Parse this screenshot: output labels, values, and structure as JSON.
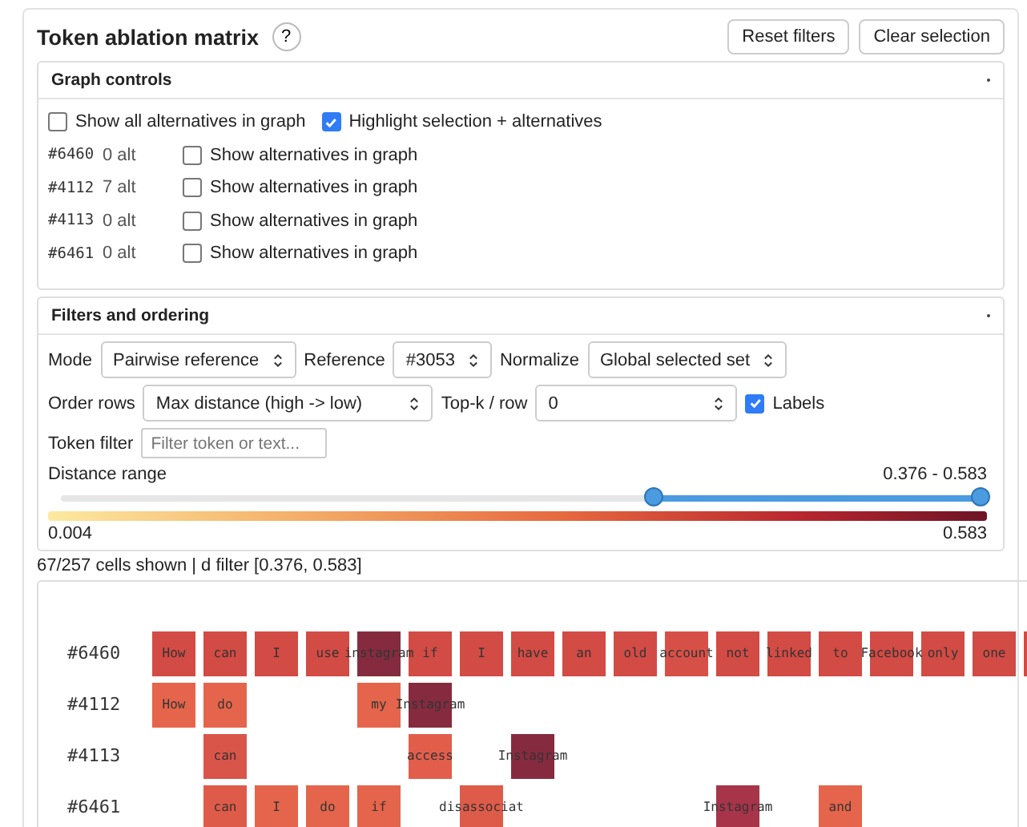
{
  "title": "Token ablation matrix",
  "help": "?",
  "buttons": [
    "Reset filters",
    "Clear selection"
  ],
  "graph_controls": {
    "title": "Graph controls",
    "options": [
      {
        "label": "Show all alternatives in graph",
        "checked": false
      },
      {
        "label": "Highlight selection + alternatives",
        "checked": true
      }
    ],
    "rows": [
      {
        "id": "#6460",
        "alt": "0 alt",
        "label": "Show alternatives in graph",
        "checked": false
      },
      {
        "id": "#4112",
        "alt": "7 alt",
        "label": "Show alternatives in graph",
        "checked": false
      },
      {
        "id": "#4113",
        "alt": "0 alt",
        "label": "Show alternatives in graph",
        "checked": false
      },
      {
        "id": "#6461",
        "alt": "0 alt",
        "label": "Show alternatives in graph",
        "checked": false
      }
    ]
  },
  "filters": {
    "title": "Filters and ordering",
    "mode": {
      "label": "Mode",
      "value": "Pairwise reference"
    },
    "reference": {
      "label": "Reference",
      "value": "#3053"
    },
    "normalize": {
      "label": "Normalize",
      "value": "Global selected set"
    },
    "order": {
      "label": "Order rows",
      "value": "Max distance (high -> low)"
    },
    "topk": {
      "label": "Top-k / row",
      "value": "0"
    },
    "labels": {
      "label": "Labels",
      "checked": true
    },
    "token_filter": {
      "label": "Token filter",
      "placeholder": "Filter token or text..."
    },
    "distance_range": {
      "label": "Distance range",
      "reading": "0.376 - 0.583",
      "low": {
        "level": 0.644
      },
      "high": {
        "level": 1
      }
    },
    "scale": {
      "min": "0.004",
      "max": "0.583"
    }
  },
  "status": "67/257 cells shown | d filter [0.376, 0.583]",
  "matrix": {
    "rows": [
      {
        "id": "#6460",
        "cells": [
          {
            "token": "How",
            "color": "#d24b44"
          },
          {
            "token": "can",
            "color": "#d24b44"
          },
          {
            "token": "I",
            "color": "#d24b44"
          },
          {
            "token": "use",
            "color": "#d24b44"
          },
          {
            "token": "instagram",
            "color": "#862b3f"
          },
          {
            "token": "if",
            "color": "#d24b44"
          },
          {
            "token": "I",
            "color": "#d24b44"
          },
          {
            "token": "have",
            "color": "#d24b44"
          },
          {
            "token": "an",
            "color": "#d24b44"
          },
          {
            "token": "old",
            "color": "#d24b44"
          },
          {
            "token": "account",
            "color": "#d75047"
          },
          {
            "token": "not",
            "color": "#d24b44"
          },
          {
            "token": "linked",
            "color": "#d24b44"
          },
          {
            "token": "to",
            "color": "#d24b44"
          },
          {
            "token": "Facebook",
            "color": "#d24b44"
          },
          {
            "token": "only",
            "color": "#d24b44"
          },
          {
            "token": "one",
            "color": "#d24b44"
          },
          {
            "color": "#d24b44"
          }
        ]
      },
      {
        "id": "#4112",
        "cells": [
          {
            "token": "How",
            "color": "#e4654b"
          },
          {
            "token": "do",
            "color": "#e4654b"
          },
          null,
          null,
          {
            "token": "my",
            "color": "#e4654b"
          },
          {
            "token": "Instagram",
            "color": "#862b3f"
          }
        ]
      },
      {
        "id": "#4113",
        "cells": [
          null,
          {
            "token": "can",
            "color": "#d9554a"
          },
          null,
          null,
          null,
          {
            "token": "access",
            "color": "#e25e4b"
          },
          null,
          {
            "token": "Instagram",
            "color": "#862b3f"
          }
        ]
      },
      {
        "id": "#6461",
        "cells": [
          null,
          {
            "token": "can",
            "color": "#df5b49"
          },
          {
            "token": "I",
            "color": "#e4654b"
          },
          {
            "token": "do",
            "color": "#e4654b"
          },
          {
            "token": "if",
            "color": "#e4654b"
          },
          null,
          {
            "token": "disassociat",
            "color": "#df5b49"
          },
          null,
          null,
          null,
          null,
          {
            "token": "Instagram",
            "color": "#a8344a"
          },
          null,
          {
            "token": "and",
            "color": "#e4654b"
          }
        ]
      }
    ]
  }
}
